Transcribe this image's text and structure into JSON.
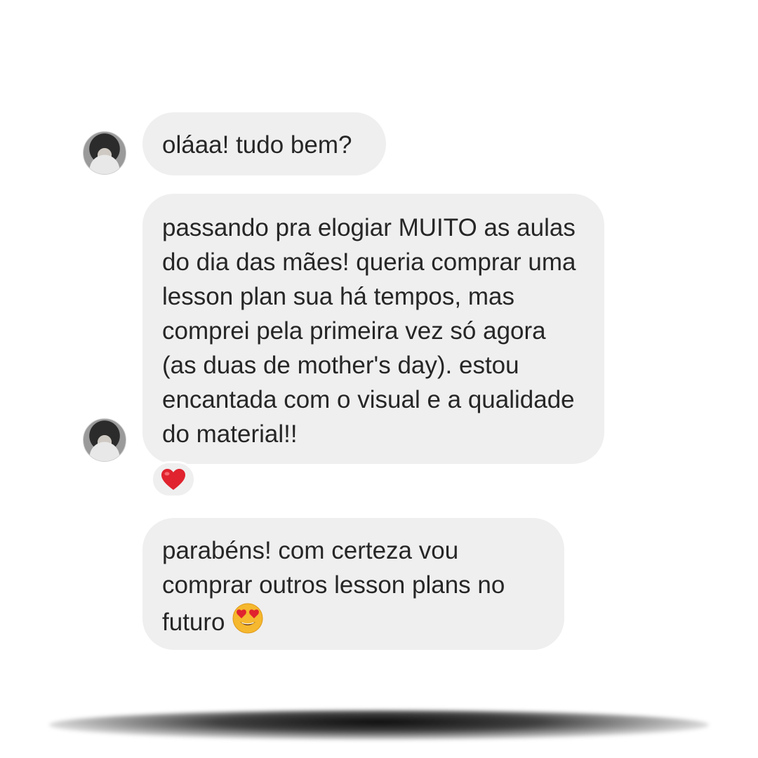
{
  "messages": [
    {
      "text": "oláaa! tudo bem?",
      "has_avatar": true
    },
    {
      "text": "passando pra elogiar MUITO as aulas do dia das mães! queria comprar uma lesson plan sua há tempos, mas comprei pela primeira vez só agora (as duas de mother's day). estou encantada com o visual e a qualidade do material!!",
      "has_avatar": true,
      "reaction": "heart-icon"
    },
    {
      "text": "parabéns! com certeza vou comprar outros lesson plans no futuro",
      "trailing_emoji": "heart-eyes-emoji"
    }
  ],
  "colors": {
    "bubble": "#efefef",
    "text": "#262626",
    "heart": "#e0232e",
    "emoji_face": "#f5b82e"
  }
}
